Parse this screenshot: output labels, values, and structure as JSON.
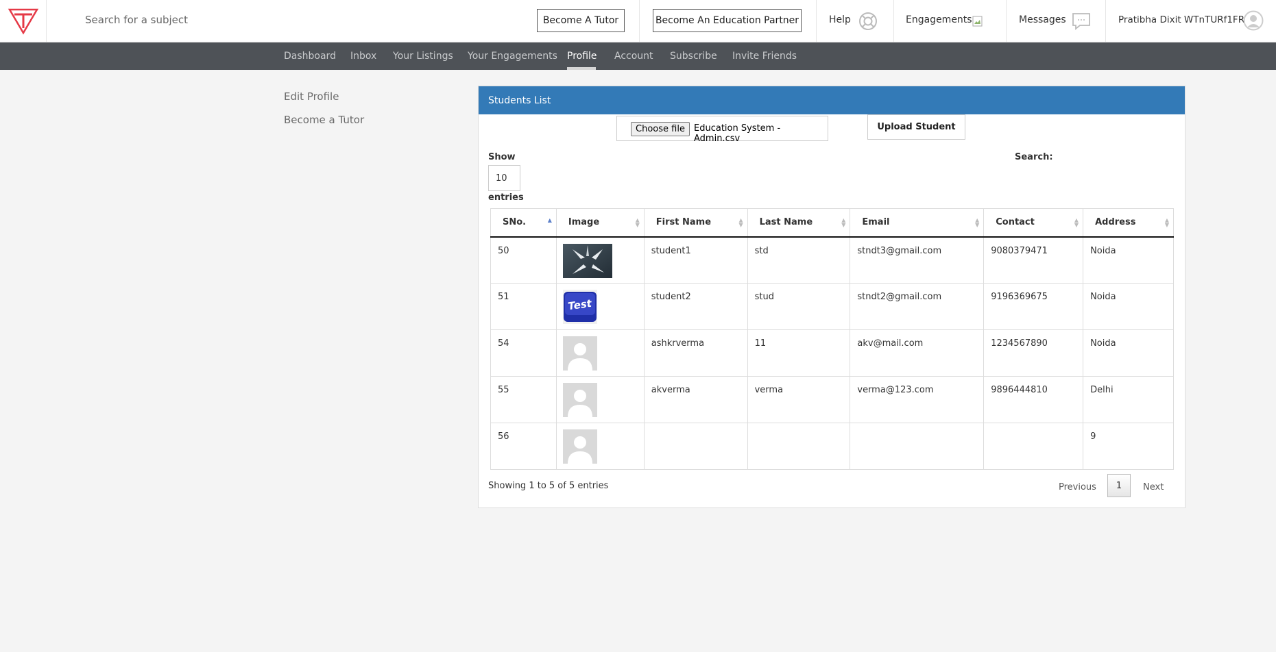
{
  "header": {
    "search_placeholder": "Search for a subject",
    "become_tutor": "Become A Tutor",
    "become_partner": "Become An Education Partner",
    "help": "Help",
    "engagements": "Engagements",
    "messages": "Messages",
    "user_name": "Pratibha Dixit WTnTURf1FR"
  },
  "nav": {
    "items": [
      "Dashboard",
      "Inbox",
      "Your Listings",
      "Your Engagements",
      "Profile",
      "Account",
      "Subscribe",
      "Invite Friends"
    ],
    "active": "Profile"
  },
  "sidebar": {
    "items": [
      "Edit Profile",
      "Become a Tutor"
    ]
  },
  "panel": {
    "title": "Students List",
    "choose_file": "Choose file",
    "file_name": "Education System - Admin.csv",
    "upload": "Upload Student",
    "show_label": "Show",
    "show_value": "10",
    "entries_label": "entries",
    "search_label": "Search:"
  },
  "table": {
    "columns": [
      "SNo.",
      "Image",
      "First Name",
      "Last Name",
      "Email",
      "Contact",
      "Address"
    ],
    "rows": [
      {
        "sno": "50",
        "image": "arrows-photo",
        "first": "student1",
        "last": "std",
        "email": "stndt3@gmail.com",
        "contact": "9080379471",
        "address": "Noida"
      },
      {
        "sno": "51",
        "image": "test-key-photo",
        "first": "student2",
        "last": "stud",
        "email": "stndt2@gmail.com",
        "contact": "9196369675",
        "address": "Noida"
      },
      {
        "sno": "54",
        "image": "avatar-placeholder",
        "first": "ashkrverma",
        "last": "11",
        "email": "akv@mail.com",
        "contact": "1234567890",
        "address": "Noida"
      },
      {
        "sno": "55",
        "image": "avatar-placeholder",
        "first": "akverma",
        "last": "verma",
        "email": "verma@123.com",
        "contact": "9896444810",
        "address": "Delhi"
      },
      {
        "sno": "56",
        "image": "avatar-placeholder",
        "first": "",
        "last": "",
        "email": "",
        "contact": "",
        "address": "9"
      }
    ]
  },
  "footer": {
    "info": "Showing 1 to 5 of 5 entries",
    "previous": "Previous",
    "current_page": "1",
    "next": "Next"
  },
  "colors": {
    "panel_header": "#337ab7",
    "nav_bg": "#4e5257",
    "logo_red": "#e53946"
  }
}
